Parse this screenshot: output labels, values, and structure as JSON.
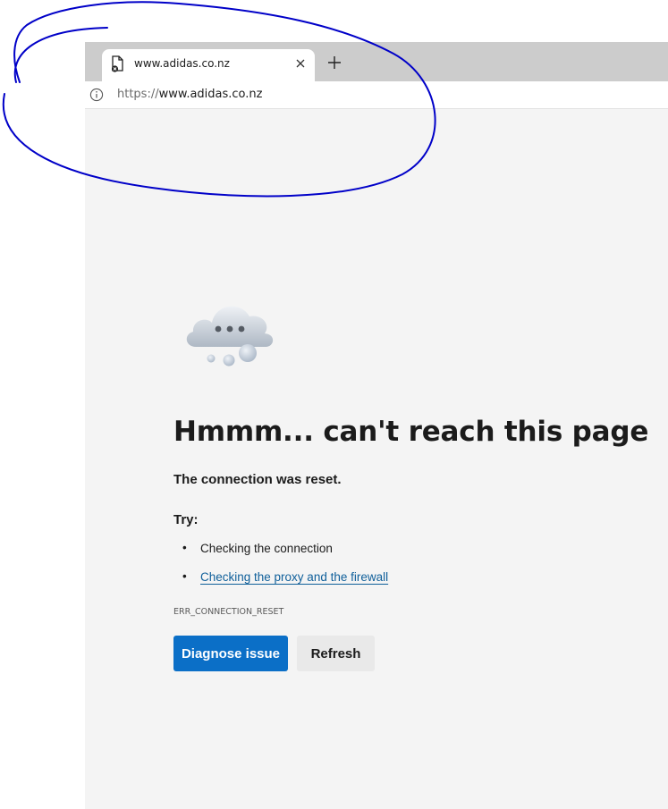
{
  "tab": {
    "title": "www.adidas.co.nz",
    "favicon": "error-page-icon",
    "close_icon": "close-icon",
    "new_tab_icon": "plus-icon"
  },
  "addressbar": {
    "info_icon": "info-icon",
    "url_scheme": "https://",
    "url_host": "www.adidas.co.nz"
  },
  "error": {
    "illustration": "cloud-icon",
    "heading": "Hmmm... can't reach this page",
    "reason": "The connection was reset.",
    "try_label": "Try:",
    "suggestions": [
      {
        "text": "Checking the connection",
        "is_link": false
      },
      {
        "text": "Checking the proxy and the firewall",
        "is_link": true
      }
    ],
    "code": "ERR_CONNECTION_RESET",
    "buttons": {
      "diagnose": "Diagnose issue",
      "refresh": "Refresh"
    }
  },
  "colors": {
    "tabstrip": "#cccccc",
    "page_background": "#f4f4f4",
    "primary_button": "#0b6fc7",
    "link": "#0f5f9a",
    "annotation_ink": "#0000c8"
  }
}
